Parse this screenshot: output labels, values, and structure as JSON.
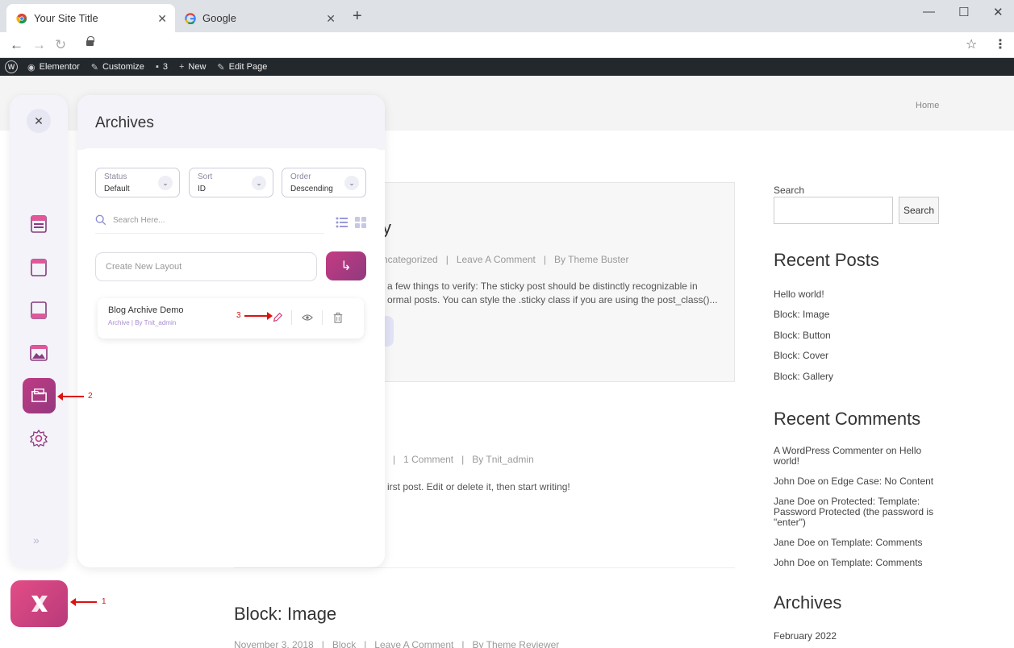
{
  "browser": {
    "tabs": [
      {
        "title": "Your Site Title",
        "close": "✕"
      },
      {
        "title": "Google",
        "close": "✕"
      }
    ],
    "new_tab": "+",
    "window": {
      "minimize": "—",
      "maximize": "☐",
      "close": "✕"
    },
    "nav": {
      "back": "←",
      "forward": "→",
      "reload": "↻",
      "star": "☆",
      "menu": "⋮"
    }
  },
  "adminbar": {
    "items": [
      {
        "label": "Elementor",
        "icon": "elementor-icon"
      },
      {
        "label": "Customize",
        "icon": "brush-icon"
      },
      {
        "label": "3",
        "icon": "comment-icon"
      },
      {
        "label": "New",
        "icon": "plus-icon"
      },
      {
        "label": "Edit Page",
        "icon": "pencil-icon"
      }
    ]
  },
  "site": {
    "home_link": "Home",
    "posts": [
      {
        "title_fragment": "y",
        "meta": "ncategorized   |   Leave A Comment   |   By Theme Buster",
        "excerpt_line1": "a few things to verify: The sticky post should be distinctly recognizable in",
        "excerpt_line2": "ormal posts. You can style the .sticky class if you are using the post_class()..."
      },
      {
        "meta": "|   1 Comment   |   By Tnit_admin",
        "excerpt": "irst post. Edit or delete it, then start writing!"
      },
      {
        "title": "Block: Image",
        "meta": "November 3, 2018   |   Block   |   Leave A Comment   |   By Theme Reviewer"
      }
    ],
    "sidebar": {
      "search_label": "Search",
      "search_button": "Search",
      "recent_posts_title": "Recent Posts",
      "recent_posts": [
        "Hello world!",
        "Block: Image",
        "Block: Button",
        "Block: Cover",
        "Block: Gallery"
      ],
      "recent_comments_title": "Recent Comments",
      "recent_comments": [
        "A WordPress Commenter on Hello world!",
        "John Doe on Edge Case: No Content",
        "Jane Doe on Protected: Template: Password Protected (the password is \"enter\")",
        "Jane Doe on Template: Comments",
        "John Doe on Template: Comments"
      ],
      "archives_title": "Archives",
      "archives": [
        "February 2022"
      ]
    }
  },
  "rail": {
    "close": "✕",
    "more": "»",
    "fab_label": "✕"
  },
  "panel": {
    "title": "Archives",
    "filters": [
      {
        "label": "Status",
        "value": "Default"
      },
      {
        "label": "Sort",
        "value": "ID"
      },
      {
        "label": "Order",
        "value": "Descending"
      }
    ],
    "search_placeholder": "Search Here...",
    "create_placeholder": "Create New Layout",
    "create_button": "↳",
    "layouts": [
      {
        "title": "Blog Archive Demo",
        "sub": "Archive  |  By Tnit_admin"
      }
    ]
  },
  "annotations": [
    "1",
    "2",
    "3"
  ],
  "colors": {
    "accent": "#c03a84",
    "accent_dark": "#903a7e",
    "admin_bar": "#23282d"
  }
}
